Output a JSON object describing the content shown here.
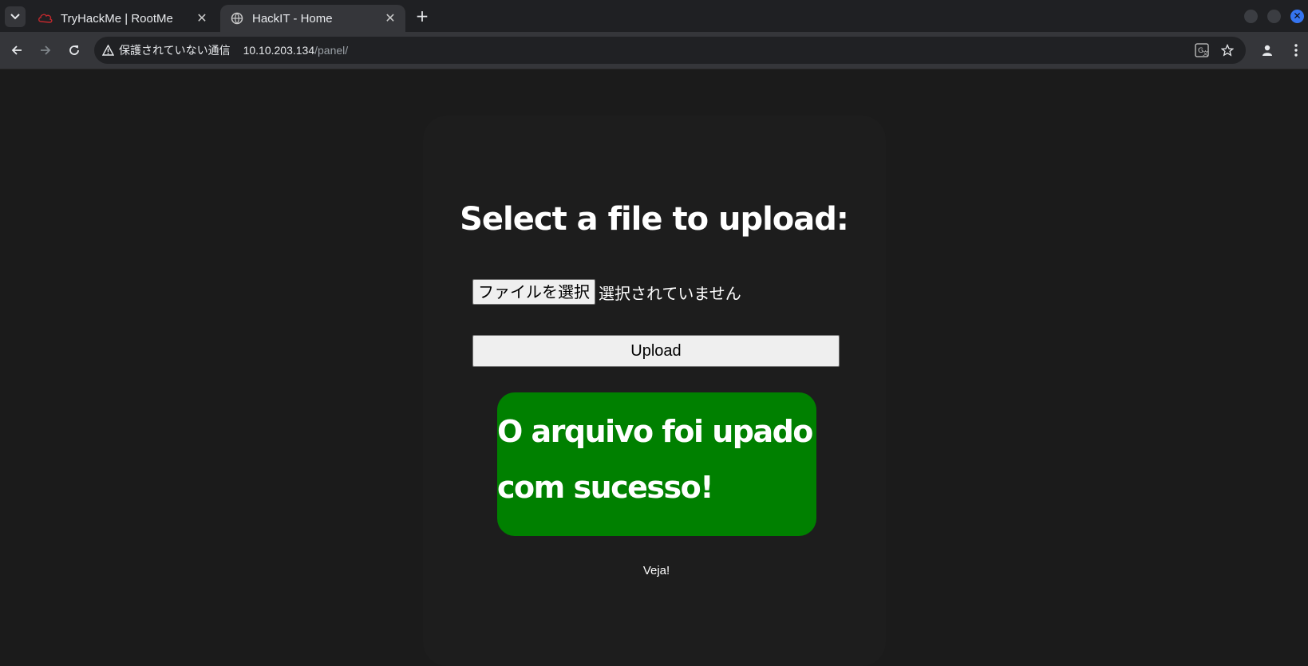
{
  "browser": {
    "tabs": [
      {
        "title": "TryHackMe | RootMe",
        "active": false,
        "icon": "tryhackme-cloud-icon"
      },
      {
        "title": "HackIT - Home",
        "active": true,
        "icon": "globe-icon"
      }
    ],
    "address": {
      "security_label": "保護されていない通信",
      "host": "10.10.203.134",
      "path": "/panel/"
    }
  },
  "page": {
    "heading": "Select a file to upload:",
    "file_button_label": "ファイルを選択",
    "file_status": "選択されていません",
    "upload_button_label": "Upload",
    "success_message": "O arquivo foi upado com sucesso!",
    "link_text": "Veja!"
  },
  "colors": {
    "page_background": "#1b1b1b",
    "success_background": "#008000",
    "accent_close": "#3574f0"
  }
}
